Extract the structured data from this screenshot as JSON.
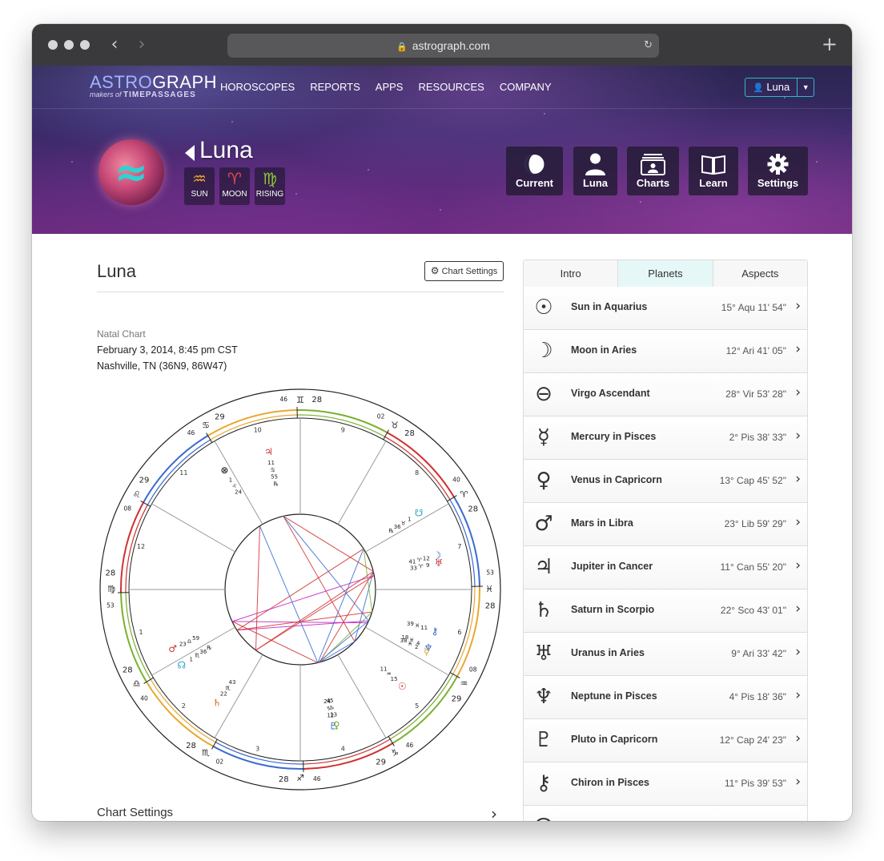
{
  "browser": {
    "url": "astrograph.com"
  },
  "site": {
    "logo": {
      "part1": "ASTRO",
      "part2": "GRAPH",
      "tagline_prefix": "makers of",
      "tagline_brand": "TIMEPASSAGES"
    },
    "nav": [
      "HOROSCOPES",
      "REPORTS",
      "APPS",
      "RESOURCES",
      "COMPANY"
    ],
    "user_button": "Luna"
  },
  "profile": {
    "name": "Luna",
    "signs": [
      {
        "glyph": "♒",
        "label": "SUN",
        "color": "#f0a830"
      },
      {
        "glyph": "♈",
        "label": "MOON",
        "color": "#e84850"
      },
      {
        "glyph": "♍",
        "label": "RISING",
        "color": "#8ac832"
      }
    ],
    "quick_actions": [
      "Current",
      "Luna",
      "Charts",
      "Learn",
      "Settings"
    ]
  },
  "chart": {
    "title": "Luna",
    "settings_button": "Chart Settings",
    "type": "Natal Chart",
    "datetime": "February 3, 2014, 8:45 pm CST",
    "location": "Nashville, TN (36N9, 86W47)",
    "settings_row": "Chart Settings"
  },
  "wheel": {
    "house_numbers": [
      "1",
      "2",
      "3",
      "4",
      "5",
      "6",
      "7",
      "8",
      "9",
      "10",
      "11",
      "12"
    ],
    "cusps": [
      {
        "deg": "28",
        "glyph": "♍",
        "min": "53"
      },
      {
        "deg": "28",
        "glyph": "♎",
        "min": "40"
      },
      {
        "deg": "28",
        "glyph": "♏",
        "min": "02"
      },
      {
        "deg": "28",
        "glyph": "♐",
        "min": "46"
      },
      {
        "deg": "29",
        "glyph": "♑",
        "min": "46"
      },
      {
        "deg": "29",
        "glyph": "♒",
        "min": "08"
      },
      {
        "deg": "28",
        "glyph": "♓",
        "min": "53"
      },
      {
        "deg": "28",
        "glyph": "♈",
        "min": "40"
      },
      {
        "deg": "28",
        "glyph": "♉",
        "min": "02"
      },
      {
        "deg": "28",
        "glyph": "♊",
        "min": "46"
      },
      {
        "deg": "29",
        "glyph": "♋",
        "min": "46"
      },
      {
        "deg": "29",
        "glyph": "♌",
        "min": "08"
      }
    ],
    "planets": [
      {
        "glyph": "♃",
        "lines": [
          "11",
          "♋",
          "55",
          "℞"
        ],
        "color": "#c83030"
      },
      {
        "glyph": "⊗",
        "lines": [
          "1",
          "♌",
          "24"
        ],
        "color": "#333333"
      },
      {
        "glyph": "☋",
        "lines": [
          "1",
          "♉",
          "36",
          "℞"
        ],
        "color": "#2aa8c8"
      },
      {
        "glyph": "☽",
        "lines": [
          "12",
          "♈",
          "41"
        ],
        "color": "#2a60d0"
      },
      {
        "glyph": "♅",
        "lines": [
          "9",
          "♈",
          "33"
        ],
        "color": "#c83030"
      },
      {
        "glyph": "♆",
        "lines": [
          "4",
          "♓",
          "18"
        ],
        "color": "#2a60d0"
      },
      {
        "glyph": "⚷",
        "lines": [
          "11",
          "♓",
          "39"
        ],
        "color": "#2a60d0"
      },
      {
        "glyph": "☿",
        "lines": [
          "2",
          "♓",
          "38"
        ],
        "color": "#d0a020"
      },
      {
        "glyph": "☉",
        "lines": [
          "15",
          "♒",
          "11"
        ],
        "color": "#c83030"
      },
      {
        "glyph": "♇",
        "lines": [
          "12",
          "♑",
          "24"
        ],
        "color": "#2a60d0"
      },
      {
        "glyph": "♀",
        "lines": [
          "13",
          "♑",
          "45"
        ],
        "color": "#70a830"
      },
      {
        "glyph": "♄",
        "lines": [
          "22",
          "♏",
          "43"
        ],
        "color": "#c86a20"
      },
      {
        "glyph": "☊",
        "lines": [
          "1",
          "♏",
          "36",
          "℞"
        ],
        "color": "#2aa8c8"
      },
      {
        "glyph": "♂",
        "lines": [
          "23",
          "♎",
          "59"
        ],
        "color": "#c83030"
      }
    ]
  },
  "tabs": [
    "Intro",
    "Planets",
    "Aspects"
  ],
  "planets": [
    {
      "glyph": "☉",
      "name": "Sun in Aquarius",
      "degree": "15° Aqu 11' 54\""
    },
    {
      "glyph": "☽",
      "name": "Moon in Aries",
      "degree": "12° Ari 41' 05\""
    },
    {
      "glyph": "⊖",
      "name": "Virgo Ascendant",
      "degree": "28° Vir 53' 28\""
    },
    {
      "glyph": "☿",
      "name": "Mercury in Pisces",
      "degree": "2° Pis 38' 33\""
    },
    {
      "glyph": "♀",
      "name": "Venus in Capricorn",
      "degree": "13° Cap 45' 52\""
    },
    {
      "glyph": "♂",
      "name": "Mars in Libra",
      "degree": "23° Lib 59' 29\""
    },
    {
      "glyph": "♃",
      "name": "Jupiter in Cancer",
      "degree": "11° Can 55' 20\""
    },
    {
      "glyph": "♄",
      "name": "Saturn in Scorpio",
      "degree": "22° Sco 43' 01\""
    },
    {
      "glyph": "♅",
      "name": "Uranus in Aries",
      "degree": "9° Ari 33' 42\""
    },
    {
      "glyph": "♆",
      "name": "Neptune in Pisces",
      "degree": "4° Pis 18' 36\""
    },
    {
      "glyph": "♇",
      "name": "Pluto in Capricorn",
      "degree": "12° Cap 24' 23\""
    },
    {
      "glyph": "⚷",
      "name": "Chiron in Pisces",
      "degree": "11° Pis 39' 53\""
    },
    {
      "glyph": "☊",
      "name": "",
      "degree": ""
    }
  ],
  "colors": {
    "accent": "#2fb9c6",
    "fire": "#d03030",
    "earth": "#7ab030",
    "air": "#e8a830",
    "water": "#3a6ad0"
  }
}
